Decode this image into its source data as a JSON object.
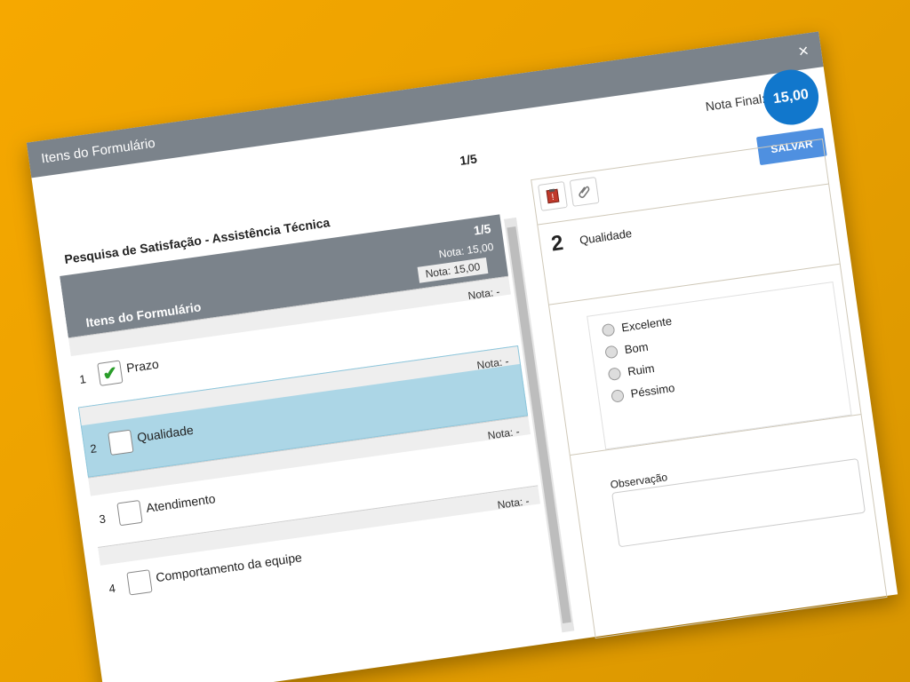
{
  "dialog": {
    "window_title": "Itens do Formulário",
    "close_glyph": "×",
    "pager_top": "1/5",
    "final_label": "Nota Final:",
    "final_value": "15,00",
    "save_label": "SALVAR"
  },
  "left": {
    "survey_title": "Pesquisa de Satisfação - Assistência Técnica",
    "section": {
      "pager": "1/5",
      "nota_total": "Nota: 15,00",
      "label": "Itens do Formulário",
      "nota": "Nota: 15,00"
    },
    "items": [
      {
        "num": "1",
        "text": "Prazo",
        "nota": "Nota: -",
        "checked": true
      },
      {
        "num": "2",
        "text": "Qualidade",
        "nota": "Nota: -",
        "checked": false,
        "selected": true
      },
      {
        "num": "3",
        "text": "Atendimento",
        "nota": "Nota: -",
        "checked": false
      },
      {
        "num": "4",
        "text": "Comportamento da equipe",
        "nota": "Nota: -",
        "checked": false
      }
    ]
  },
  "right": {
    "question_number": "2",
    "question_title": "Qualidade",
    "options": [
      "Excelente",
      "Bom",
      "Ruim",
      "Péssimo"
    ],
    "observation_label": "Observação"
  },
  "icons": {
    "checkmark": "check-icon",
    "clipboard": "clipboard-alert-icon",
    "paperclip": "paperclip-icon",
    "close": "close-icon"
  }
}
